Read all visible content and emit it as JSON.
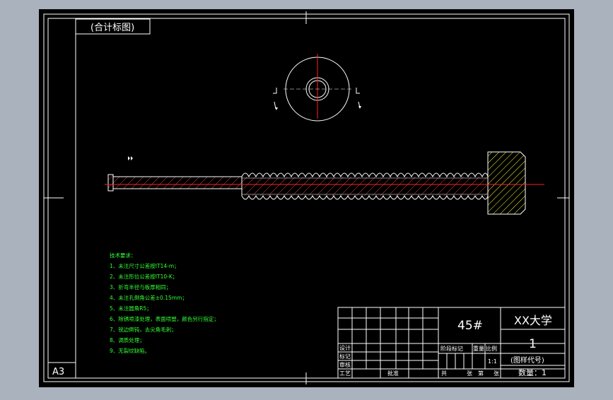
{
  "title_block": {
    "stamp": "(合计标图)",
    "sheet_size": "A3",
    "material": "45#",
    "school": "XX大学",
    "drawing_no": "1",
    "drawing_code": "(图样代号)",
    "quantity": "数量：1",
    "scale": "1:1",
    "row_design": "设计",
    "row_draw": "标记",
    "row_check": "审核",
    "row_process": "工艺",
    "row_approve": "批准",
    "header_labels": [
      "阶段标记",
      "重量",
      "比例"
    ],
    "sheet_labels": [
      "共",
      "张",
      "第",
      "张"
    ]
  },
  "tech_requirements": {
    "heading": "技术要求：",
    "items": [
      "1、未注尺寸公差按IT14-m；",
      "2、未注形位公差按IT10-K；",
      "3、折弯半径与板厚相同；",
      "4、未注孔倒角公差±0.15mm；",
      "5、未注圆角R5；",
      "6、除锈喷漆处理，表面喷塑，颜色另行指定；",
      "7、锐边倒钝，去尖角毛刺；",
      "8、调质处理；",
      "9、无裂纹缺陷。"
    ]
  },
  "colors": {
    "background": "#000000",
    "frame": "#ffffff",
    "hatch": "#ffff33",
    "centerline": "#ff2020",
    "notes": "#33ff33",
    "outer": "#a9b2bd"
  }
}
